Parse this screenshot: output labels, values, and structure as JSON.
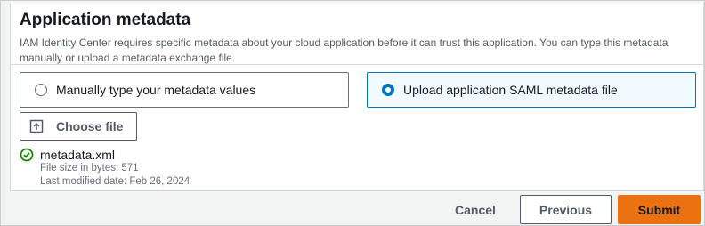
{
  "section": {
    "title": "Application metadata",
    "description": "IAM Identity Center requires specific metadata about your cloud application before it can trust this application. You can type this metadata manually or upload a metadata exchange file."
  },
  "options": {
    "manual_label": "Manually type your metadata values",
    "upload_label": "Upload application SAML metadata file",
    "selected": "upload"
  },
  "upload": {
    "choose_file_label": "Choose file",
    "file_name": "metadata.xml",
    "file_size": "File size in bytes: 571",
    "last_modified": "Last modified date: Feb 26, 2024"
  },
  "footer": {
    "cancel_label": "Cancel",
    "previous_label": "Previous",
    "submit_label": "Submit"
  },
  "colors": {
    "accent": "#0073bb",
    "submit": "#ec7211",
    "success": "#1d8102"
  }
}
